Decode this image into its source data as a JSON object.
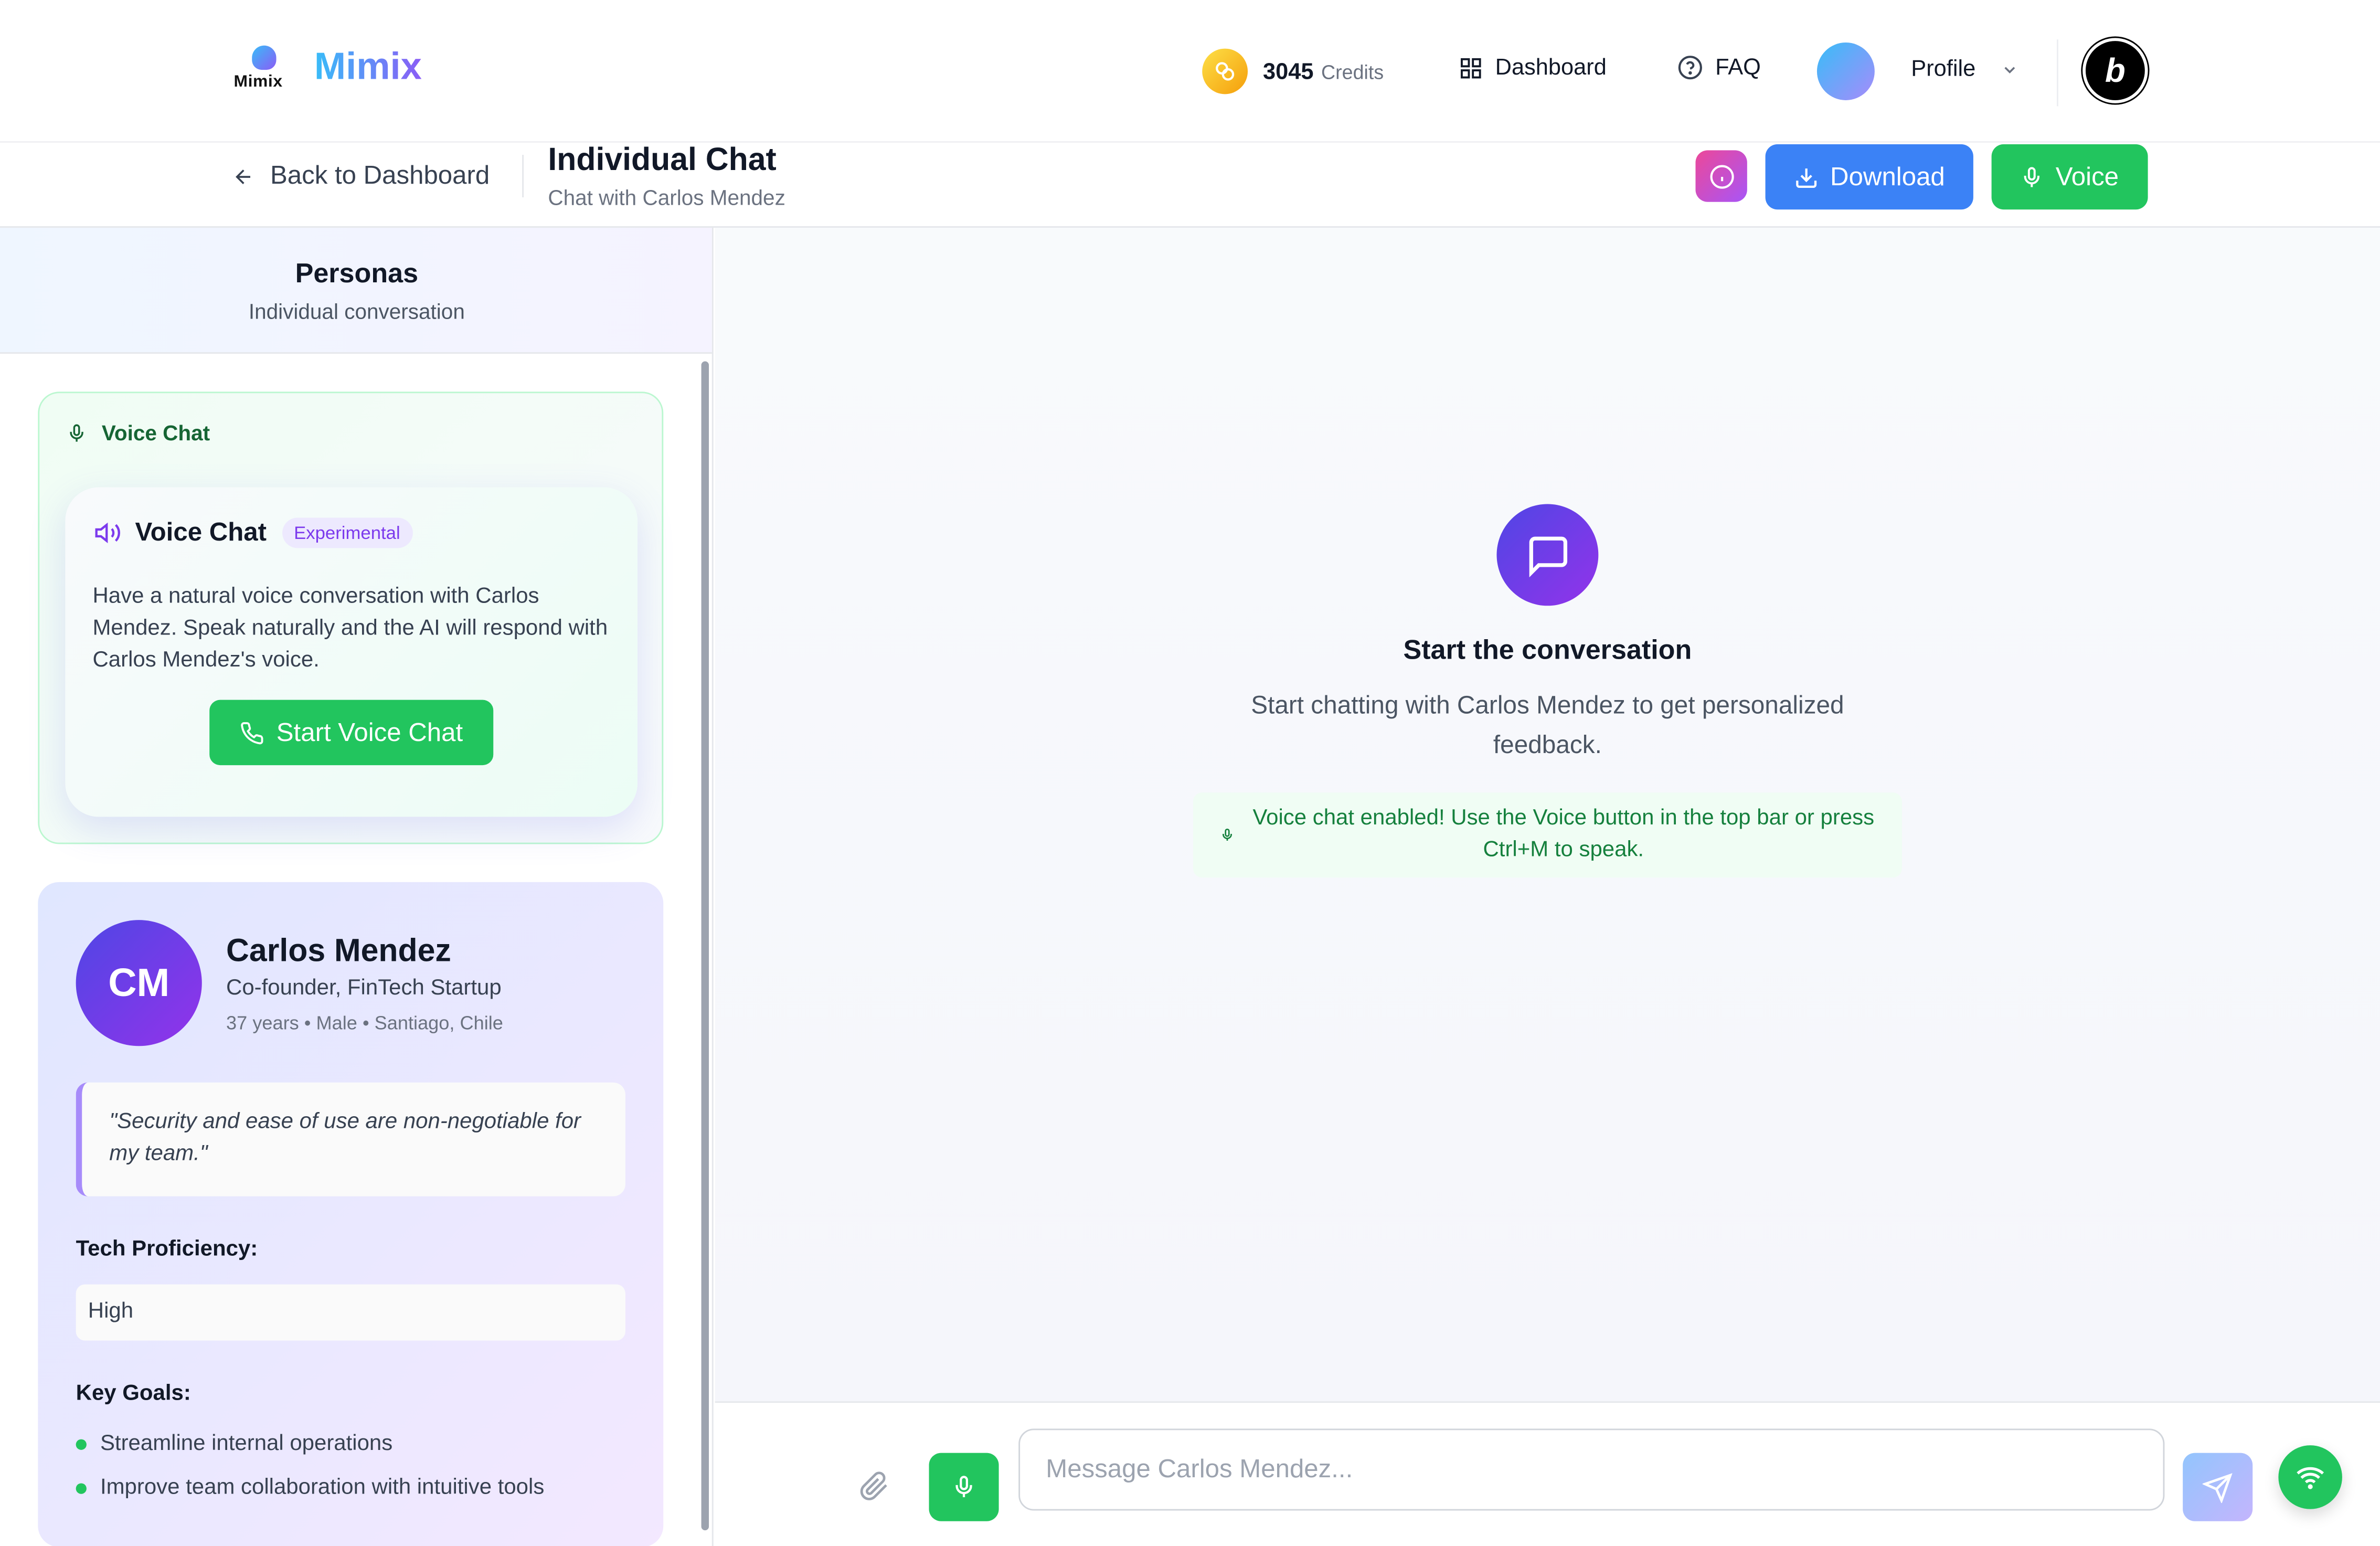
{
  "header": {
    "logo_text": "Mimix",
    "brand": "Mimix",
    "credits_value": "3045",
    "credits_label": "Credits",
    "nav": {
      "dashboard": "Dashboard",
      "faq": "FAQ",
      "profile": "Profile"
    },
    "bolt_badge": "b"
  },
  "subheader": {
    "back_label": "Back to Dashboard",
    "title": "Individual Chat",
    "subtitle": "Chat with Carlos Mendez",
    "download_label": "Download",
    "voice_label": "Voice"
  },
  "sidebar": {
    "title": "Personas",
    "subtitle": "Individual conversation",
    "voice_chat": {
      "header": "Voice Chat",
      "title": "Voice Chat",
      "badge": "Experimental",
      "description": "Have a natural voice conversation with Carlos Mendez. Speak naturally and the AI will respond with Carlos Mendez's voice.",
      "button": "Start Voice Chat"
    },
    "persona": {
      "initials": "CM",
      "name": "Carlos Mendez",
      "role": "Co-founder, FinTech Startup",
      "meta": "37 years • Male • Santiago, Chile",
      "quote": "\"Security and ease of use are non-negotiable for my team.\"",
      "tech_label": "Tech Proficiency:",
      "tech_value": "High",
      "goals_label": "Key Goals:",
      "goals": [
        "Streamline internal operations",
        "Improve team collaboration with intuitive tools"
      ]
    }
  },
  "main": {
    "empty_title": "Start the conversation",
    "empty_subtitle": "Start chatting with Carlos Mendez to get personalized feedback.",
    "hint": "Voice chat enabled! Use the Voice button in the top bar or press Ctrl+M to speak."
  },
  "input": {
    "placeholder": "Message Carlos Mendez..."
  },
  "colors": {
    "accent_green": "#22c55e",
    "accent_blue": "#3b82f6",
    "accent_purple": "#7c3aed"
  }
}
